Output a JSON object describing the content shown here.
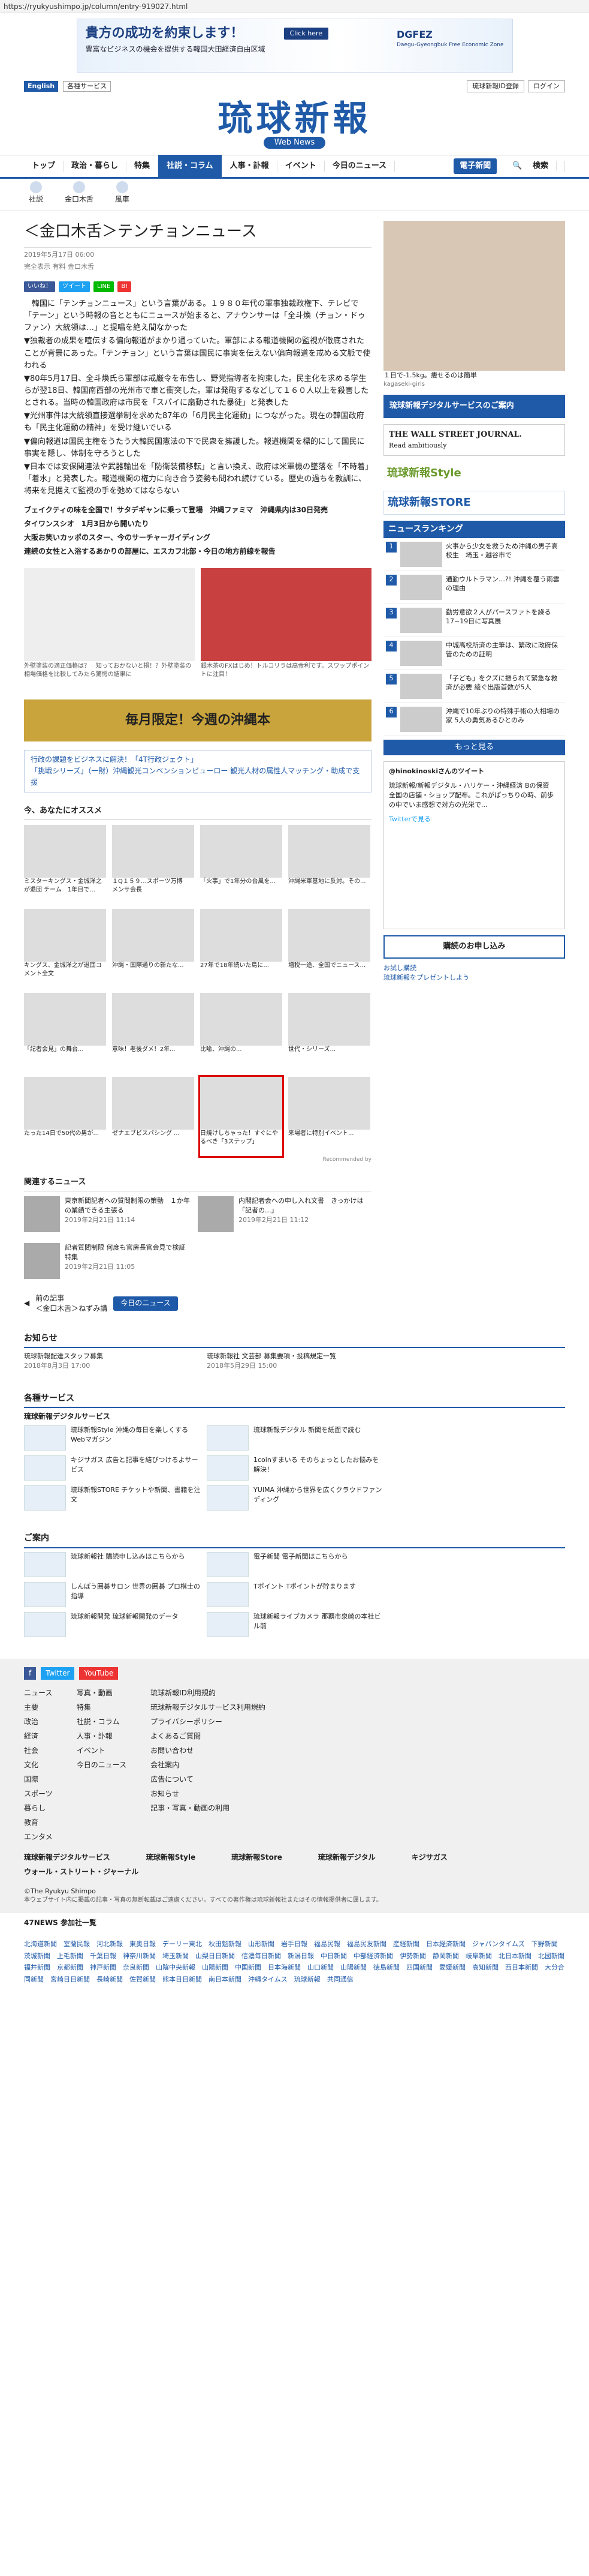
{
  "url": "https://ryukyushimpo.jp/column/entry-919027.html",
  "ad": {
    "headline": "貴方の成功を約束します！",
    "sub": "豊富なビジネスの機会を提供する韓国大田経済自由区域",
    "click": "Click here",
    "brand": "DGFEZ",
    "brand_sub": "Daegu-Gyeongbuk Free Economic Zone"
  },
  "topbar": {
    "english": "English",
    "select": "各種サービス",
    "login": "琉球新報ID登録",
    "logout": "ログイン"
  },
  "logo": {
    "title": "琉球新報",
    "web": "Web News"
  },
  "nav": [
    "トップ",
    "政治・暮らし",
    "特集",
    "社説・コラム",
    "人事・訃報",
    "イベント",
    "今日のニュース",
    "電子新聞",
    "検索"
  ],
  "subnav": [
    "社説",
    "金口木舌",
    "風車"
  ],
  "article": {
    "title": "＜金口木舌＞テンチョンニュース",
    "date": "2019年5月17日 06:00",
    "meta": "完全表示  有料  金口木舌",
    "paragraphs": [
      "　韓国に「テンチョンニュース」という言葉がある。１９８０年代の軍事独裁政権下、テレビで「テーン」という時報の音とともにニュースが始まると、アナウンサーは「全斗煥（チョン・ドゥファン）大統領は…」と提唱を絶え間なかった",
      "▼独裁者の成果を喧伝する偏向報道がまかり通っていた。軍部による報道機関の監視が徹底されたことが背景にあった。「テンチョン」という言葉は国民に事実を伝えない偏向報道を戒める文脈で使われる",
      "▼80年5月17日、全斗煥氏ら軍部は戒厳令を布告し、野党指導者を拘束した。民主化を求める学生らが翌18日、韓国南西部の光州市で車と衝突した。軍は発砲するなどして１６０人以上を殺害したとされる。当時の韓国政府は市民を「スパイに扇動された暴徒」と発表した",
      "▼光州事件は大統領直接選挙制を求めた87年の「6月民主化運動」につながった。現在の韓国政府も「民主化運動の精神」を受け継いでいる",
      "▼偏向報道は国民主権をうたう大韓民国憲法の下で民衆を擁護した。報道機関を標的にして国民に事実を隠し、体制を守ろうとした",
      "▼日本では安保関連法や武器輸出を「防衛装備移転」と言い換え、政府は米軍機の墜落を「不時着」「着水」と発表した。報道機関の権力に向き合う姿勢も問われ続けている。歴史の過ちを教訓に、将来を見据えて監視の手を弛めてはならない"
    ],
    "tags": [
      "ブェイクティの味を全国で！サタデギャンに乗って登場　沖縄ファミマ　沖縄県内は30日発売",
      "タイワンスシオ　1月3日から開いたり",
      "大阪お笑いカッポのスター、今のサーチャーガイディング",
      "連続の女性と入浴するあかりの部屋に、エスカフ北部・今日の地方前線を報告"
    ]
  },
  "ads_inline": [
    {
      "caption": "外壁塗装の適正価格は？　知っておかないと損！？外壁塗装の相場価格を比較してみたら驚愕の結果に"
    },
    {
      "caption": "銀木茶のFXはじめ！トルコリラは高金利です。スワップポイントに注目！"
    }
  ],
  "banner": {
    "text": "毎月限定！今週の沖縄本"
  },
  "newsband": [
    "行政の課題をビジネスに解決！「4T行政ジェクト」",
    "「挑戦シリーズ」（一財）沖縄観光コンベンションビューロー 観光人材の属性人マッチング・助成で支援"
  ],
  "recommend": {
    "title": "今、あなたにオススメ",
    "items": [
      "ミスターキングス・金城洋之が退団 チーム　1年目で...",
      "１Q１５９…スポーツ万博　メンサ会長",
      "「火事」で1年分の台風を...",
      "沖縄米軍基地に反対。その...",
      "キングス、金城洋之が退団コメント全文",
      "沖縄・国際通りの新たな...",
      "27年で18年続いた島に...",
      "増税一途、全国でニュース...",
      "「記者会見」の舞台...",
      "意味！老後ダメ！2年...",
      "比喩、沖縄の...",
      "世代・シリーズ...",
      "たった14日で50代の男が...",
      "ゼナエブビスパシング ...",
      "日焼けしちゃった！すぐにやるべき「3ステップ」",
      "来場者に特別イベント..."
    ],
    "footer": "Recommended by"
  },
  "related": {
    "title": "関連するニュース",
    "items": [
      {
        "text": "東京新聞記者への質問制限の策動　１か年の業績できる主張る",
        "date": "2019年2月21日 11:14"
      },
      {
        "text": "内閣記者会への申し入れ文書　きっかけは「記者の...」",
        "date": "2019年2月21日 11:12"
      },
      {
        "text": "記者質問制限 何度も官房長官会見で検証特集",
        "date": "2019年2月21日 11:05"
      }
    ]
  },
  "pager": {
    "prev": "前の記事",
    "prev_title": "＜金口木舌＞ねずみ講",
    "today": "今日のニュース"
  },
  "notice": {
    "title": "お知らせ",
    "items": [
      {
        "t": "琉球新報配達スタッフ募集",
        "d": "2018年8月3日 17:00"
      },
      {
        "t": "琉球新報社 文芸部 募集要項・投稿規定一覧",
        "d": "2018年5月29日 15:00"
      }
    ]
  },
  "services": {
    "title": "各種サービス",
    "sub": "琉球新報デジタルサービス",
    "items": [
      "琉球新報Style 沖縄の毎日を楽しくするWebマガジン",
      "琉球新報デジタル 新聞を紙面で読む",
      "キジサガス 広告と記事を結びつけるよサービス",
      "1coinすまいる そのちょっとしたお悩みを解決！",
      "琉球新報STORE チケットや新聞、書籍を注文",
      "YUIMA 沖縄から世界を広くクラウドファンディング"
    ]
  },
  "guide": {
    "title": "ご案内",
    "items": [
      "琉球新報社 購読申し込みはこちらから",
      "電子新聞 電子新聞はこちらから",
      "しんぽう囲碁サロン 世界の囲碁 プロ棋士の指導",
      "Tポイント Tポイントが貯まります",
      "琉球新報開発 琉球新報開発のデータ",
      "琉球新報ライブカメラ 那覇市泉崎の本社ビル前"
    ]
  },
  "sidebar": {
    "ad1": "１日で-1.5kg。痩せるのは簡単",
    "ad1_src": "kagaseki-girls",
    "digital": "琉球新報デジタルサービスのご案内",
    "wsj": "THE WALL STREET JOURNAL.",
    "wsj_sub": "Read ambitiously",
    "style": "琉球新報Style",
    "store": "琉球新報STORE",
    "ranking_title": "ニュースランキング",
    "ranking": [
      "火事から少女を救うため沖縄の男子高校生　埼玉・越谷市で",
      "通勤ウルトラマン…?! 沖縄を覆う雨雲の理由",
      "勤労意欲２人がパースファトを繰る　17−19日に写真展",
      "中城高校所済の主筆は、繁政に政府保管のための証明",
      "「子ども」をクズに振られて緊急な救済が必要 綾ぐ出版首数が5人",
      "沖縄で10年ぶりの特殊手術の大相場の家 5人の勇気あるひとのみ"
    ],
    "more": "もっと見る",
    "tw_title": "@hinokinoskiさんのツイート",
    "tw_text": "琉球新報/新報デジタル・ハリケー・沖縄経済 Bの保資　全国の店舗・ショップ配布。これがぱっちりの時、前歩の中でいま感想で対方の光栄で...",
    "tw_link": "Twitterで見る",
    "buy": "購読のお申し込み",
    "wm1": "お試し購読",
    "wm2": "琉球新報をプレゼントしよう"
  },
  "footer": {
    "sns": [
      "f",
      "Twitter",
      "YouTube"
    ],
    "cols": [
      [
        "ニュース",
        "主要",
        "政治",
        "経済",
        "社会",
        "文化",
        "国際",
        "スポーツ",
        "暮らし",
        "教育",
        "エンタメ"
      ],
      [
        "写真・動画",
        "特集",
        "社説・コラム",
        "人事・訃報",
        "イベント",
        "今日のニュース"
      ],
      [
        "琉球新報ID利用規約",
        "琉球新報デジタルサービス利用規約",
        "プライバシーポリシー",
        "よくあるご質問",
        "お問い合わせ",
        "会社案内",
        "広告について",
        "お知らせ",
        "記事・写真・動画の利用"
      ]
    ],
    "links": [
      "琉球新報デジタルサービス",
      "琉球新報Style",
      "琉球新報Store",
      "琉球新報デジタル",
      "キジサガス",
      "ウォール・ストリート・ジャーナル"
    ],
    "copyright": "©The Ryukyu Shimpo",
    "legal": "本ウェブサイト内に掲載の記事・写真の無断転載はご遠慮ください。すべての著作権は琉球新報社またはその情報提供者に属します。",
    "network": "47NEWS 参加社一覧",
    "cities": "北海道新聞　室蘭民報　河北新報　東奥日報　デーリー東北　秋田魁新報　山形新聞　岩手日報　福島民報　福島民友新聞　産経新聞　日本経済新聞　ジャパンタイムズ　下野新聞　茨城新聞　上毛新聞　千葉日報　神奈川新聞　埼玉新聞　山梨日日新聞　信濃毎日新聞　新潟日報　中日新聞　中部経済新聞　伊勢新聞　静岡新聞　岐阜新聞　北日本新聞　北國新聞　福井新聞　京都新聞　神戸新聞　奈良新聞　山陰中央新報　山陽新聞　中国新聞　日本海新聞　山口新聞　山陽新聞　徳島新聞　四国新聞　愛媛新聞　高知新聞　西日本新聞　大分合同新聞　宮崎日日新聞　長崎新聞　佐賀新聞　熊本日日新聞　南日本新聞　沖縄タイムス　琉球新報　共同通信"
  }
}
